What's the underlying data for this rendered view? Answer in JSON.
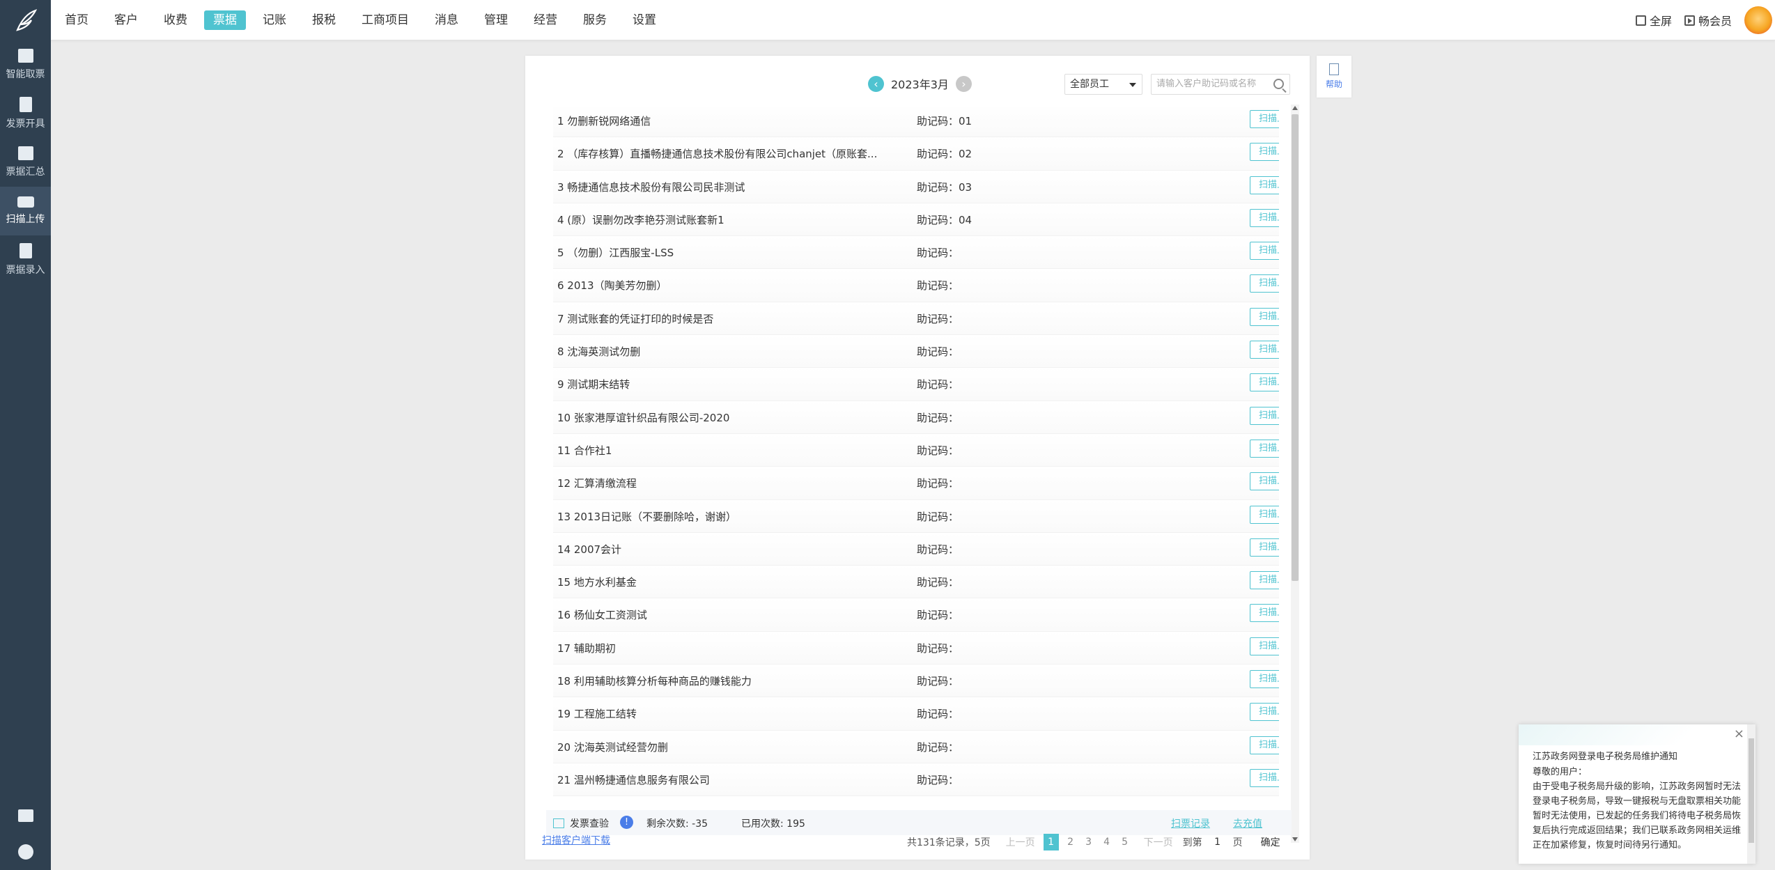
{
  "nav": {
    "items": [
      "首页",
      "客户",
      "收费",
      "票据",
      "记账",
      "报税",
      "工商项目",
      "消息",
      "管理",
      "经营",
      "服务",
      "设置"
    ],
    "active_index": 3
  },
  "top_right": {
    "fullscreen": "全屏",
    "member": "畅会员"
  },
  "sidebar": {
    "items": [
      "智能取票",
      "发票开具",
      "票据汇总",
      "扫描上传",
      "票据录入"
    ],
    "active_index": 3
  },
  "month_bar": {
    "month": "2023年3月",
    "staff_select": "全部员工",
    "search_placeholder": "请输入客户助记码或名称"
  },
  "list": {
    "code_label": "助记码：",
    "button_label": "扫描上传",
    "rows": [
      {
        "name": "1 勿删新锐网络通信",
        "code": "01"
      },
      {
        "name": "2 （库存核算）直播畅捷通信息技术股份有限公司chanjet（原账套...",
        "code": "02"
      },
      {
        "name": "3 畅捷通信息技术股份有限公司民非测试",
        "code": "03"
      },
      {
        "name": "4 (原）误删勿改李艳芬测试账套新1",
        "code": "04"
      },
      {
        "name": "5 （勿删）江西服宝-LSS",
        "code": ""
      },
      {
        "name": "6 2013（陶美芳勿删）",
        "code": ""
      },
      {
        "name": "7 测试账套的凭证打印的时候是否",
        "code": ""
      },
      {
        "name": "8 沈海英测试勿删",
        "code": ""
      },
      {
        "name": "9 测试期末结转",
        "code": ""
      },
      {
        "name": "10 张家港厚谊针织品有限公司-2020",
        "code": ""
      },
      {
        "name": "11 合作社1",
        "code": ""
      },
      {
        "name": "12 汇算清缴流程",
        "code": ""
      },
      {
        "name": "13 2013日记账（不要删除哈，谢谢）",
        "code": ""
      },
      {
        "name": "14 2007会计",
        "code": ""
      },
      {
        "name": "15 地方水利基金",
        "code": ""
      },
      {
        "name": "16 杨仙女工资测试",
        "code": ""
      },
      {
        "name": "17 辅助期初",
        "code": ""
      },
      {
        "name": "18 利用辅助核算分析每种商品的赚钱能力",
        "code": ""
      },
      {
        "name": "19 工程施工结转",
        "code": ""
      },
      {
        "name": "20 沈海英测试经营勿删",
        "code": ""
      },
      {
        "name": "21 温州畅捷通信息服务有限公司",
        "code": ""
      }
    ]
  },
  "footer": {
    "invoice_check": "发票查验",
    "remaining": "剩余次数: -35",
    "used": "已用次数: 195",
    "scan_log": "扫票记录",
    "recharge": "去充值",
    "download": "扫描客户端下载"
  },
  "pagination": {
    "total": "共131条记录，5页",
    "prev": "上一页",
    "pages": [
      "1",
      "2",
      "3",
      "4",
      "5"
    ],
    "current": "1",
    "next": "下一页",
    "goto": "到第",
    "goto_value": "1",
    "page_word": "页",
    "confirm": "确定"
  },
  "help": {
    "label": "帮助"
  },
  "notice": {
    "title": "江苏政务网登录电子税务局维护通知",
    "greeting": "尊敬的用户：",
    "body": "由于受电子税务局升级的影响，江苏政务网暂时无法登录电子税务局，导致一键报税与无盘取票相关功能暂时无法使用，已发起的任务我们将待电子税务局恢复后执行完成返回结果；我们已联系政务网相关运维正在加紧修复，恢复时间待另行通知。"
  },
  "colors": {
    "accent": "#4fc3d0",
    "sidebar": "#2f4050",
    "link_blue": "#4a7de8"
  }
}
